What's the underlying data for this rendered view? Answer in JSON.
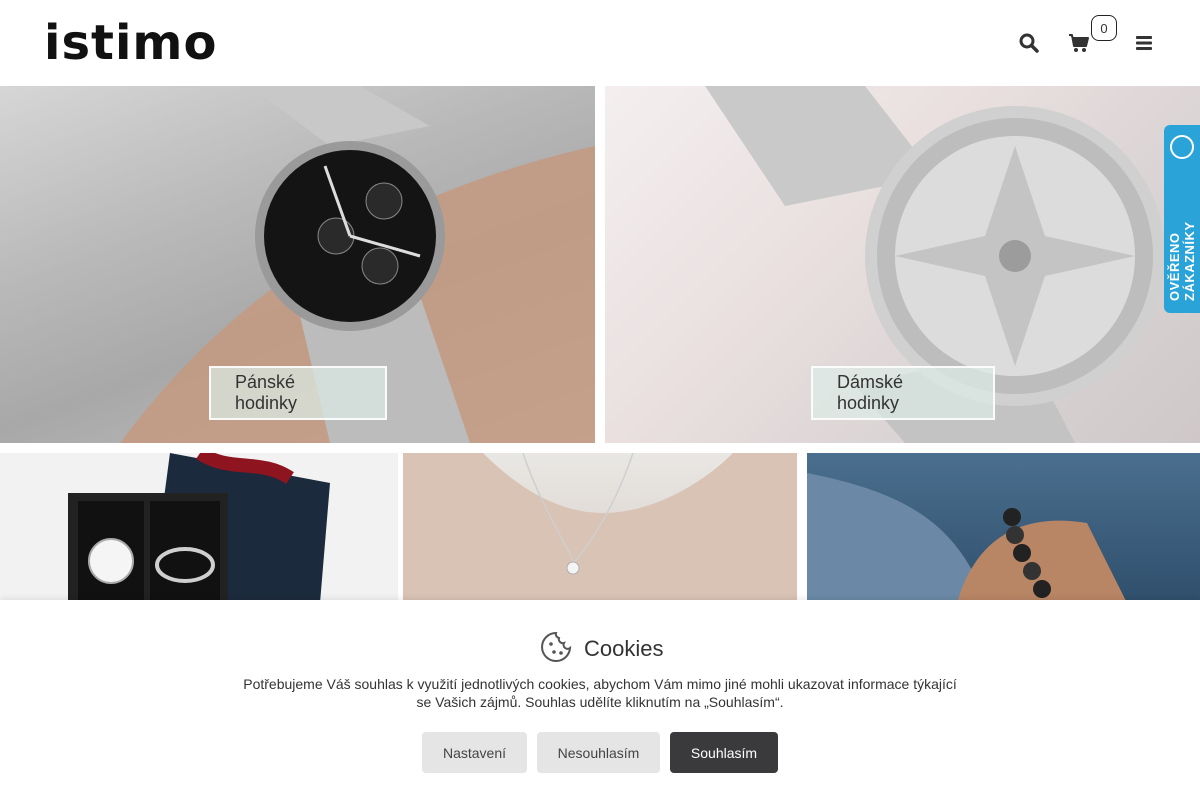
{
  "header": {
    "logo_text": "istimo",
    "cart_count": "0",
    "icons": {
      "search": "search-icon",
      "cart": "cart-icon",
      "menu": "menu-icon"
    }
  },
  "tiles": [
    {
      "label": "Pánské hodinky"
    },
    {
      "label": "Dámské hodinky"
    }
  ],
  "badge": {
    "text": "OVĚŘENO ZÁKAZNÍKY"
  },
  "cookies": {
    "title": "Cookies",
    "text": "Potřebujeme Váš souhlas k využití jednotlivých cookies, abychom Vám mimo jiné mohli ukazovat informace týkající se Vašich zájmů. Souhlas udělíte kliknutím na „Souhlasím“.",
    "buttons": {
      "settings": "Nastavení",
      "decline": "Nesouhlasím",
      "accept": "Souhlasím"
    }
  },
  "colors": {
    "accent": "#2aa3d8",
    "dark_button": "#3a3a3c",
    "light_button": "#e5e5e5"
  }
}
